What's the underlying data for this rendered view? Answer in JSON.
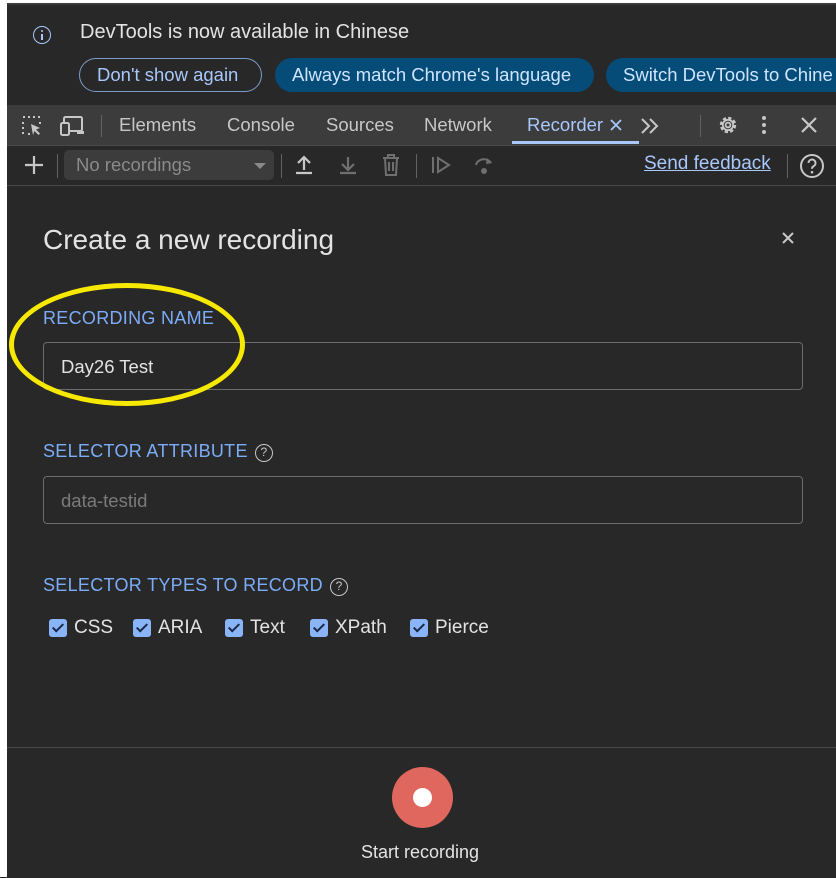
{
  "infobar": {
    "message": "DevTools is now available in Chinese",
    "dont_show": "Don't show again",
    "match_language": "Always match Chrome's language",
    "switch_language": "Switch DevTools to Chine"
  },
  "tabs": [
    {
      "label": "Elements"
    },
    {
      "label": "Console"
    },
    {
      "label": "Sources"
    },
    {
      "label": "Network"
    },
    {
      "label": "Recorder"
    }
  ],
  "toolbar": {
    "recordings_select": "No recordings",
    "send_feedback": "Send feedback"
  },
  "form": {
    "title": "Create a new recording",
    "recording_name_label": "RECORDING NAME",
    "recording_name_value": "Day26 Test",
    "selector_attribute_label": "SELECTOR ATTRIBUTE",
    "selector_attribute_placeholder": "data-testid",
    "selector_types_label": "SELECTOR TYPES TO RECORD",
    "selector_types": [
      {
        "label": "CSS",
        "checked": true
      },
      {
        "label": "ARIA",
        "checked": true
      },
      {
        "label": "Text",
        "checked": true
      },
      {
        "label": "XPath",
        "checked": true
      },
      {
        "label": "Pierce",
        "checked": true
      }
    ]
  },
  "footer": {
    "start_recording": "Start recording"
  },
  "colors": {
    "accent": "#a8c7fa",
    "record_button": "#e0675d",
    "annotation_highlight": "#f7e900",
    "panel_background": "#282828"
  }
}
